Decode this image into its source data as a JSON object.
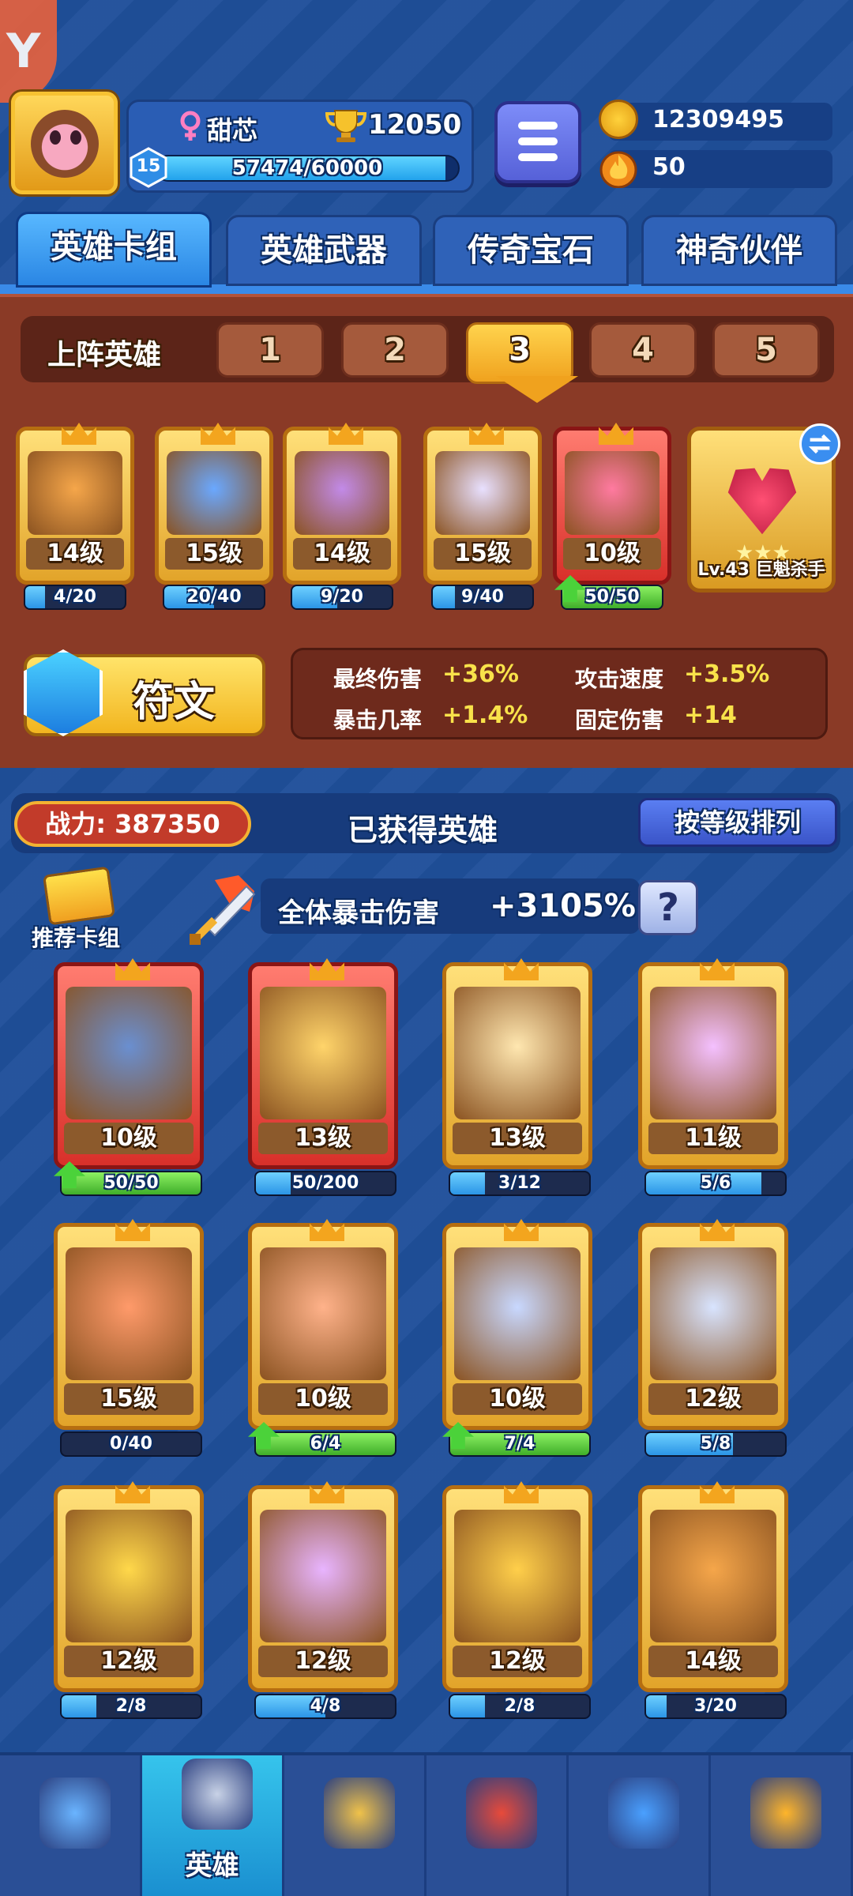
{
  "profile": {
    "nickname": "甜芯",
    "trophies": "12050",
    "level": "15",
    "xp_text": "57474/60000",
    "xp_fraction": 0.958
  },
  "resources": {
    "coins": "12309495",
    "energy": "50"
  },
  "tabs": [
    {
      "label": "英雄卡组",
      "active": true
    },
    {
      "label": "英雄武器",
      "active": false
    },
    {
      "label": "传奇宝石",
      "active": false
    },
    {
      "label": "神奇伙伴",
      "active": false
    }
  ],
  "lineup": {
    "label": "上阵英雄",
    "slots": [
      "1",
      "2",
      "3",
      "4",
      "5"
    ],
    "active_slot": "3",
    "heroes": [
      {
        "level": "14级",
        "progress": "4/20",
        "fraction": 0.2,
        "upgrade": false,
        "frame": "gold"
      },
      {
        "level": "15级",
        "progress": "20/40",
        "fraction": 0.5,
        "upgrade": false,
        "frame": "gold"
      },
      {
        "level": "14级",
        "progress": "9/20",
        "fraction": 0.45,
        "upgrade": false,
        "frame": "gold"
      },
      {
        "level": "15级",
        "progress": "9/40",
        "fraction": 0.225,
        "upgrade": false,
        "frame": "gold"
      },
      {
        "level": "10级",
        "progress": "50/50",
        "fraction": 1.0,
        "upgrade": true,
        "frame": "red"
      }
    ],
    "pet": {
      "label": "Lv.43 巨魁杀手",
      "stars": 3
    }
  },
  "rune": {
    "label": "符文",
    "stats": [
      {
        "name": "最终伤害",
        "value": "+36%"
      },
      {
        "name": "攻击速度",
        "value": "+3.5%"
      },
      {
        "name": "暴击几率",
        "value": "+1.4%"
      },
      {
        "name": "固定伤害",
        "value": "+14"
      }
    ]
  },
  "owned": {
    "power": "战力: 387350",
    "title": "已获得英雄",
    "sort_label": "按等级排列",
    "deck_label": "推荐卡组",
    "crit_name": "全体暴击伤害",
    "crit_value": "+3105%",
    "help": "?",
    "heroes": [
      {
        "level": "10级",
        "progress": "50/50",
        "fraction": 1.0,
        "upgrade": true,
        "frame": "red"
      },
      {
        "level": "13级",
        "progress": "50/200",
        "fraction": 0.25,
        "upgrade": false,
        "frame": "red"
      },
      {
        "level": "13级",
        "progress": "3/12",
        "fraction": 0.25,
        "upgrade": false,
        "frame": "gold"
      },
      {
        "level": "11级",
        "progress": "5/6",
        "fraction": 0.83,
        "upgrade": false,
        "frame": "gold"
      },
      {
        "level": "15级",
        "progress": "0/40",
        "fraction": 0.0,
        "upgrade": false,
        "frame": "gold"
      },
      {
        "level": "10级",
        "progress": "6/4",
        "fraction": 1.0,
        "upgrade": true,
        "frame": "gold"
      },
      {
        "level": "10级",
        "progress": "7/4",
        "fraction": 1.0,
        "upgrade": true,
        "frame": "gold"
      },
      {
        "level": "12级",
        "progress": "5/8",
        "fraction": 0.625,
        "upgrade": false,
        "frame": "gold"
      },
      {
        "level": "12级",
        "progress": "2/8",
        "fraction": 0.25,
        "upgrade": false,
        "frame": "gold"
      },
      {
        "level": "12级",
        "progress": "4/8",
        "fraction": 0.5,
        "upgrade": false,
        "frame": "gold"
      },
      {
        "level": "12级",
        "progress": "2/8",
        "fraction": 0.25,
        "upgrade": false,
        "frame": "gold"
      },
      {
        "level": "14级",
        "progress": "3/20",
        "fraction": 0.15,
        "upgrade": false,
        "frame": "gold"
      }
    ]
  },
  "nav": [
    {
      "icon": "treasure-chest-icon",
      "label": "",
      "active": false
    },
    {
      "icon": "knight-helmet-icon",
      "label": "英雄",
      "active": true
    },
    {
      "icon": "crossed-swords-icon",
      "label": "",
      "active": false
    },
    {
      "icon": "crown-shield-icon",
      "label": "",
      "active": false
    },
    {
      "icon": "social-board-icon",
      "label": "",
      "active": false
    },
    {
      "icon": "compass-icon",
      "label": "",
      "active": false
    }
  ],
  "colors": {
    "background": "#1f4f9a",
    "panel_red": "#8a3a26",
    "accent_gold": "#f0a21e",
    "stat_value": "#f8e24a"
  }
}
